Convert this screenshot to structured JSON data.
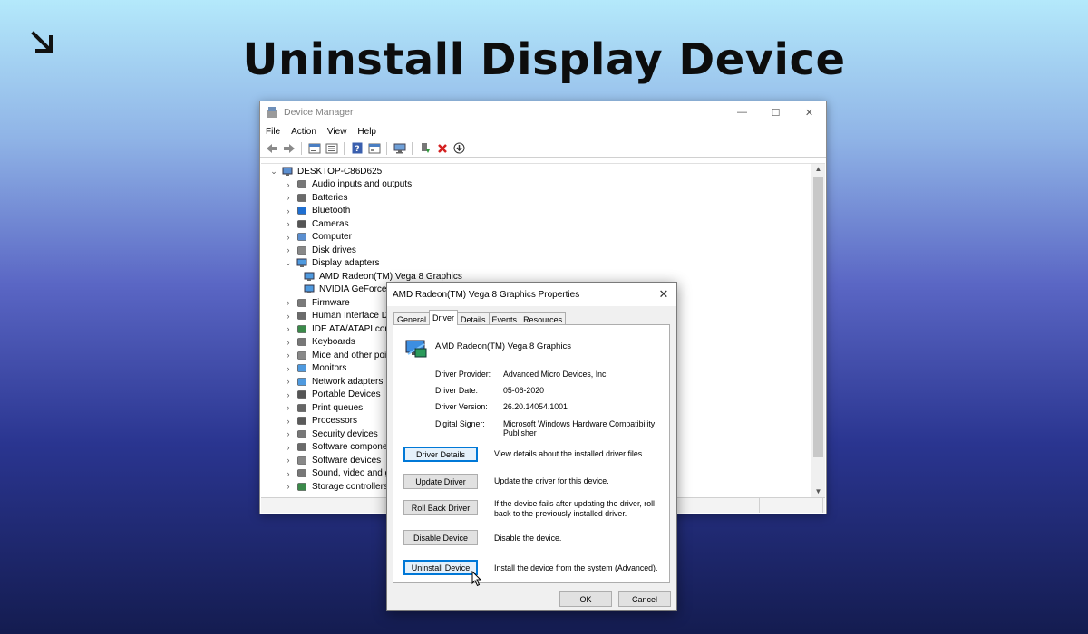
{
  "banner": {
    "title": "Uninstall Display Device",
    "arrow_icon": "arrow-down-right-icon"
  },
  "device_manager": {
    "title": "Device Manager",
    "controls": {
      "minimize": "—",
      "maximize": "☐",
      "close": "✕"
    },
    "menu": [
      "File",
      "Action",
      "View",
      "Help"
    ],
    "toolbar_icons": [
      "back-icon",
      "forward-icon",
      "properties-icon",
      "list-icon",
      "help-icon",
      "console-icon",
      "scan-icon",
      "update-driver-icon",
      "uninstall-icon",
      "download-icon"
    ],
    "tree": {
      "root": "DESKTOP-C86D625",
      "categories_before": [
        {
          "label": "Audio inputs and outputs",
          "icon": "speaker-icon"
        },
        {
          "label": "Batteries",
          "icon": "battery-icon"
        },
        {
          "label": "Bluetooth",
          "icon": "bluetooth-icon"
        },
        {
          "label": "Cameras",
          "icon": "camera-icon"
        },
        {
          "label": "Computer",
          "icon": "computer-icon"
        },
        {
          "label": "Disk drives",
          "icon": "disk-icon"
        }
      ],
      "expanded": {
        "label": "Display adapters",
        "children": [
          "AMD Radeon(TM) Vega 8 Graphics",
          "NVIDIA GeForce"
        ]
      },
      "categories_after": [
        {
          "label": "Firmware",
          "icon": "firmware-icon"
        },
        {
          "label": "Human Interface De",
          "icon": "hid-icon"
        },
        {
          "label": "IDE ATA/ATAPI contr",
          "icon": "ide-icon"
        },
        {
          "label": "Keyboards",
          "icon": "keyboard-icon"
        },
        {
          "label": "Mice and other poin",
          "icon": "mouse-icon"
        },
        {
          "label": "Monitors",
          "icon": "monitor-icon"
        },
        {
          "label": "Network adapters",
          "icon": "network-icon"
        },
        {
          "label": "Portable Devices",
          "icon": "portable-icon"
        },
        {
          "label": "Print queues",
          "icon": "printer-icon"
        },
        {
          "label": "Processors",
          "icon": "processor-icon"
        },
        {
          "label": "Security devices",
          "icon": "security-icon"
        },
        {
          "label": "Software componen",
          "icon": "software-component-icon"
        },
        {
          "label": "Software devices",
          "icon": "software-device-icon"
        },
        {
          "label": "Sound, video and gai",
          "icon": "sound-icon"
        },
        {
          "label": "Storage controllers",
          "icon": "storage-icon"
        }
      ]
    }
  },
  "properties_dialog": {
    "title": "AMD Radeon(TM) Vega 8 Graphics Properties",
    "close": "✕",
    "tabs": [
      "General",
      "Driver",
      "Details",
      "Events",
      "Resources"
    ],
    "active_tab": "Driver",
    "device_name": "AMD Radeon(TM) Vega 8 Graphics",
    "info": [
      {
        "label": "Driver Provider:",
        "value": "Advanced Micro Devices, Inc."
      },
      {
        "label": "Driver Date:",
        "value": "05-06-2020"
      },
      {
        "label": "Driver Version:",
        "value": "26.20.14054.1001"
      },
      {
        "label": "Digital Signer:",
        "value": "Microsoft Windows Hardware Compatibility Publisher"
      }
    ],
    "actions": [
      {
        "button": "Driver Details",
        "desc": "View details about the installed driver files."
      },
      {
        "button": "Update Driver",
        "desc": "Update the driver for this device."
      },
      {
        "button": "Roll Back Driver",
        "desc": "If the device fails after updating the driver, roll back to the previously installed driver."
      },
      {
        "button": "Disable Device",
        "desc": "Disable the device."
      },
      {
        "button": "Uninstall Device",
        "desc": "Install the device from the system (Advanced)."
      }
    ],
    "ok": "OK",
    "cancel": "Cancel"
  }
}
